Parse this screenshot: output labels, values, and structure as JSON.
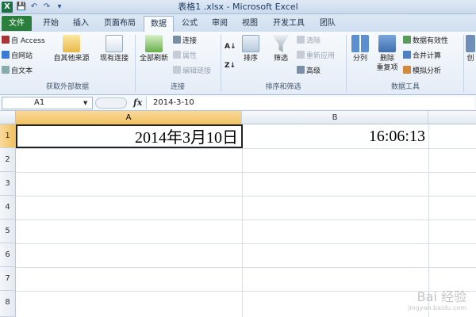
{
  "title": "表格1 .xlsx - Microsoft Excel",
  "qat": {
    "save": "💾",
    "undo": "↶",
    "redo": "↷",
    "more": "▾"
  },
  "tabs": {
    "file": "文件",
    "home": "开始",
    "insert": "插入",
    "layout": "页面布局",
    "data": "数据",
    "formulas": "公式",
    "review": "审阅",
    "view": "视图",
    "developer": "开发工具",
    "team": "团队"
  },
  "ribbon": {
    "external": {
      "access": "自 Access",
      "web": "自网站",
      "text": "自文本",
      "other": "自其他来源",
      "existing": "现有连接",
      "label": "获取外部数据"
    },
    "connections": {
      "refresh": "全部刷新",
      "conn": "连接",
      "props": "属性",
      "edit": "编辑链接",
      "label": "连接"
    },
    "sort": {
      "sort": "排序",
      "filter": "筛选",
      "clear": "清除",
      "reapply": "重新应用",
      "advanced": "高级",
      "label": "排序和筛选"
    },
    "tools": {
      "split": "分列",
      "remove": "删除",
      "remove2": "重复项",
      "validation": "数据有效性",
      "consolidate": "合并计算",
      "whatif": "模拟分析",
      "label": "数据工具"
    },
    "outline": {
      "create": "创"
    }
  },
  "formula_bar": {
    "name_box": "A1",
    "fx": "fx",
    "value": "2014-3-10"
  },
  "columns": [
    "A",
    "B"
  ],
  "rows": [
    "1",
    "2",
    "3",
    "4",
    "5",
    "6",
    "7",
    "8"
  ],
  "cells": {
    "A1": "2014年3月10日",
    "B1": "16:06:13"
  },
  "watermark": {
    "text": "Bai 经验",
    "sub": "jingyan.baidu.com"
  },
  "colors": {
    "file_tab": "#2a7f3c",
    "selected_header": "#f1c15f",
    "ribbon_border": "#a9bcd6"
  }
}
